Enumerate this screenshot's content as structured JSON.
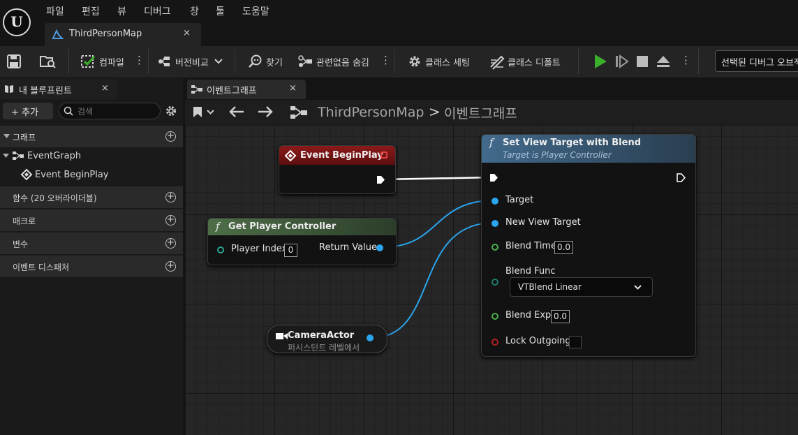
{
  "menu": [
    "파일",
    "편집",
    "뷰",
    "디버그",
    "창",
    "툴",
    "도움말"
  ],
  "logo_text": "U",
  "document_tab": {
    "title": "ThirdPersonMap",
    "close": "×"
  },
  "toolbar": {
    "compile": "컴파일",
    "diff": "버전비교",
    "find": "찾기",
    "hide_unrelated": "관련없음 숨김",
    "class_settings": "클래스 세팅",
    "class_defaults": "클래스 디폴트",
    "more": "⋮",
    "debug_select": "선택된 디버그 오브젝트 없음"
  },
  "left_panel": {
    "tab_title": "내 블루프린트",
    "tab_close": "×",
    "add_button": "+ 추가",
    "search_placeholder": "검색",
    "categories": {
      "graphs": "그래프",
      "functions": "함수 (20 오버라이더블)",
      "macros": "매크로",
      "variables": "변수",
      "dispatchers": "이벤트 디스패처"
    },
    "event_graph": "EventGraph",
    "event_begin_play": "Event BeginPlay"
  },
  "graph_panel": {
    "tab_title": "이벤트그래프",
    "tab_close": "×",
    "breadcrumb_root": "ThirdPersonMap",
    "breadcrumb_sep": ">",
    "breadcrumb_current": "이벤트그래프"
  },
  "nodes": {
    "begin_play": {
      "title": "Event BeginPlay"
    },
    "get_controller": {
      "title": "Get Player Controller",
      "player_index_label": "Player Index",
      "player_index_value": "0",
      "return_value_label": "Return Value"
    },
    "camera_actor": {
      "title": "CameraActor",
      "subtitle": "퍼시스턴트 레벨에서"
    },
    "set_view_target": {
      "title": "Set View Target with Blend",
      "subtitle": "Target is Player Controller",
      "target": "Target",
      "new_view_target": "New View Target",
      "blend_time": "Blend Time",
      "blend_time_value": "0.0",
      "blend_func": "Blend Func",
      "blend_func_value": "VTBlend Linear",
      "blend_exp": "Blend Exp",
      "blend_exp_value": "0.0",
      "lock_outgoing": "Lock Outgoing"
    }
  },
  "colors": {
    "event_header": "#7a1414",
    "function_header": "#3e5a3a",
    "blue_func_header": "#3a5c7c",
    "object_pin": "#2aa4ec",
    "float_pin": "#48b04c",
    "bool_pin": "#b02020",
    "play_button": "#3ab02a"
  },
  "function_glyph": "f"
}
